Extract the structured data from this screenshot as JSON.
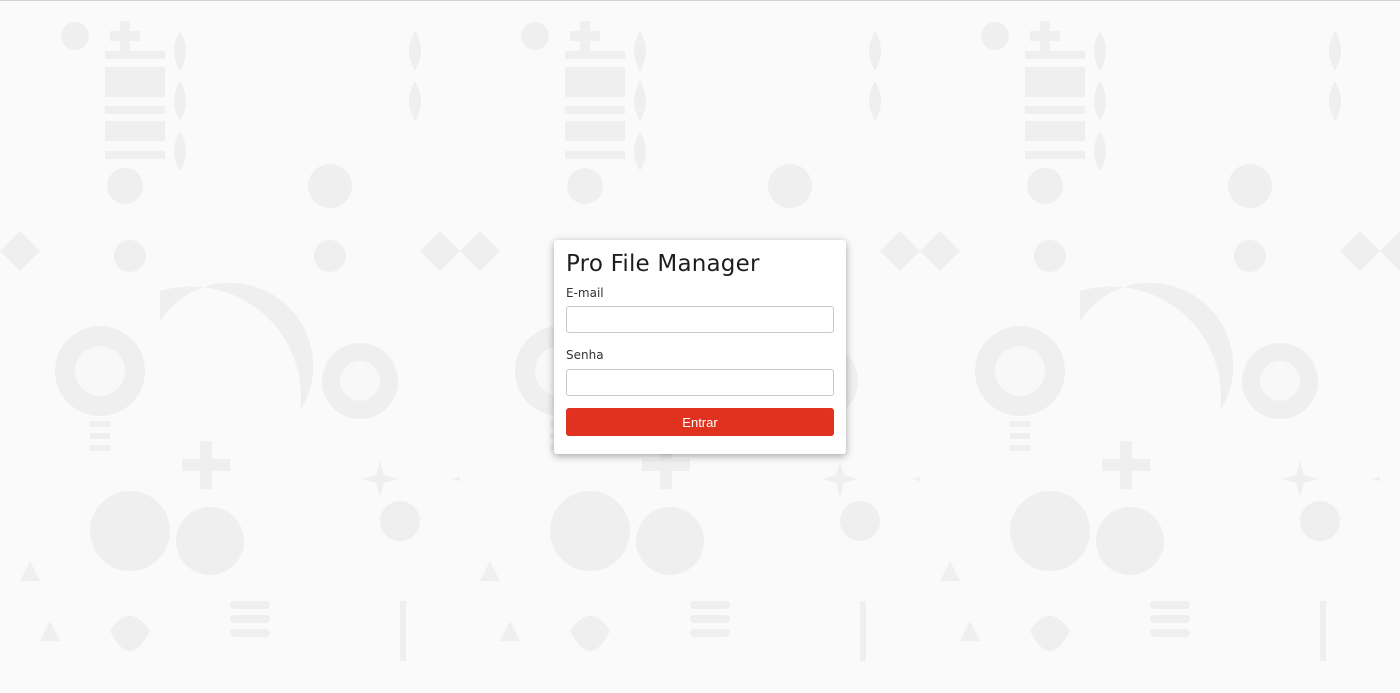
{
  "app": {
    "title": "Pro File Manager"
  },
  "form": {
    "email_label": "E-mail",
    "email_value": "",
    "email_placeholder": "",
    "password_label": "Senha",
    "password_value": "",
    "password_placeholder": "",
    "submit_label": "Entrar"
  },
  "colors": {
    "accent": "#e0321f",
    "background": "#fafafa",
    "pattern": "#f0f0f0"
  },
  "icons": {
    "background": "folk-ornament-pattern"
  }
}
